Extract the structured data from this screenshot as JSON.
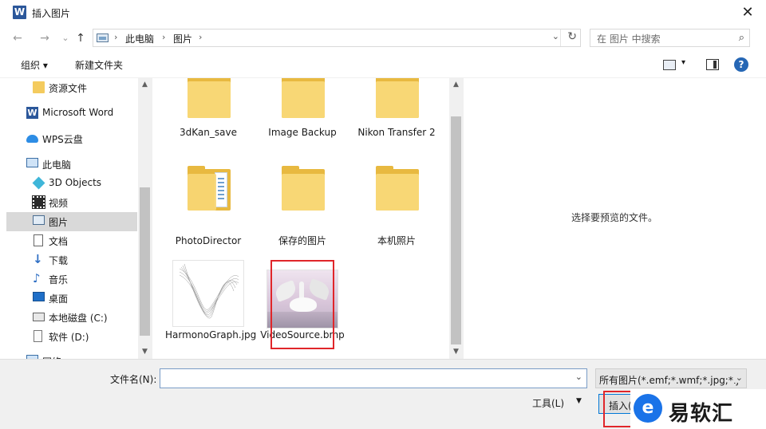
{
  "window": {
    "title": "插入图片",
    "app_icon_letter": "W",
    "close_glyph": "✕"
  },
  "address": {
    "back_glyph": "←",
    "forward_glyph": "→",
    "recent_glyph": "⌄",
    "up_glyph": "↑",
    "crumbs": [
      "此电脑",
      "图片"
    ],
    "sep_glyph": "›",
    "dropdown_glyph": "⌄",
    "refresh_glyph": "↻",
    "search_placeholder": "在 图片 中搜索",
    "search_glyph": "⌕"
  },
  "toolbar": {
    "organize_label": "组织 ▾",
    "new_folder_label": "新建文件夹",
    "view_dd_glyph": "▾",
    "help_glyph": "?"
  },
  "nav": {
    "items": [
      {
        "label": "资源文件",
        "icon": "folder-icon"
      },
      {
        "label": "Microsoft Word",
        "icon": "word-icon"
      },
      {
        "label": "WPS云盘",
        "icon": "cloud-icon"
      },
      {
        "label": "此电脑",
        "icon": "computer-icon"
      },
      {
        "label": "3D Objects",
        "icon": "cube-icon"
      },
      {
        "label": "视频",
        "icon": "video-icon"
      },
      {
        "label": "图片",
        "icon": "pictures-icon",
        "selected": true
      },
      {
        "label": "文档",
        "icon": "document-icon"
      },
      {
        "label": "下载",
        "icon": "download-icon"
      },
      {
        "label": "音乐",
        "icon": "music-icon"
      },
      {
        "label": "桌面",
        "icon": "desktop-icon"
      },
      {
        "label": "本地磁盘 (C:)",
        "icon": "drive-icon"
      },
      {
        "label": "软件 (D:)",
        "icon": "drive-icon"
      },
      {
        "label": "网络",
        "icon": "network-icon"
      }
    ],
    "down_glyph": "↓",
    "note_glyph": "♪",
    "scroll_up_glyph": "▲",
    "scroll_down_glyph": "▼"
  },
  "files": {
    "items": [
      {
        "name": "3dKan_save"
      },
      {
        "name": "Image Backup"
      },
      {
        "name": "Nikon Transfer 2"
      },
      {
        "name": "PhotoDirector"
      },
      {
        "name": "保存的图片"
      },
      {
        "name": "本机照片"
      },
      {
        "name": "HarmonoGraph.jpg"
      },
      {
        "name": "VideoSource.bmp"
      }
    ]
  },
  "preview": {
    "empty_text": "选择要预览的文件。"
  },
  "bottom": {
    "filename_label": "文件名(N):",
    "filename_value": "",
    "filter_value": "所有图片(*.emf;*.wmf;*.jpg;*.j",
    "dd_glyph": "⌄",
    "tools_label": "工具(L)",
    "tools_dd": "▼",
    "insert_label": "插入(S)"
  },
  "watermark": {
    "logo_glyph": "e",
    "text": "易软汇"
  }
}
